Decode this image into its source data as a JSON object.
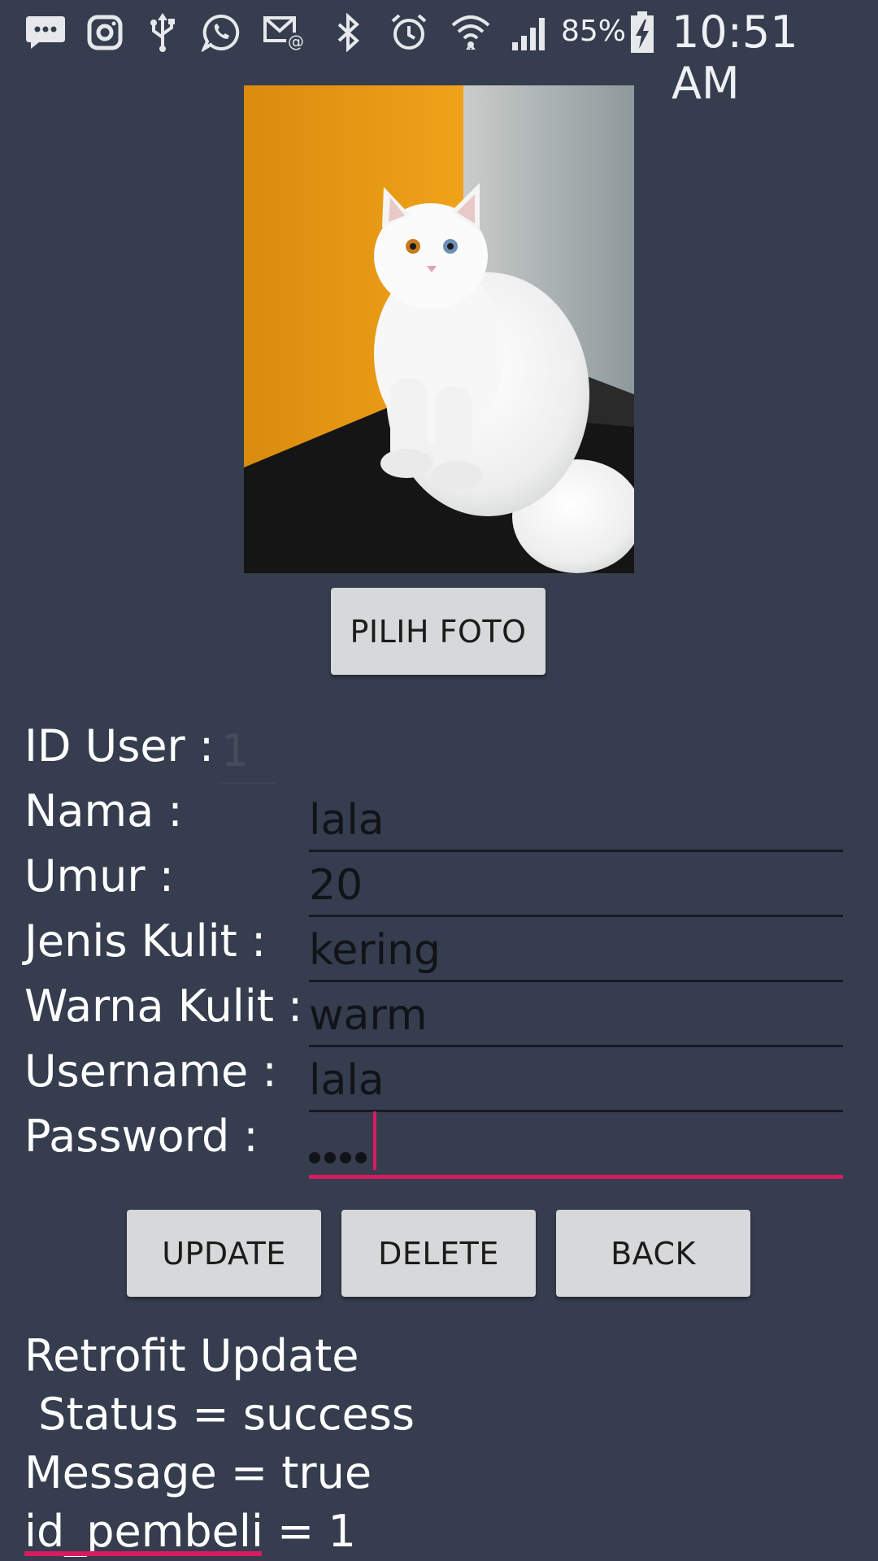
{
  "status_bar": {
    "icons": [
      "messenger-icon",
      "instagram-icon",
      "usb-icon",
      "whatsapp-icon",
      "email-icon",
      "bluetooth-icon",
      "alarm-icon",
      "wifi-icon",
      "signal-icon",
      "battery-charging-icon"
    ],
    "battery": "85%",
    "time": "10:51 AM"
  },
  "photo": {
    "subject": "white persian cat",
    "icon": "cat-photo"
  },
  "buttons": {
    "pick_photo": "PILIH FOTO",
    "update": "UPDATE",
    "delete": "DELETE",
    "back": "BACK"
  },
  "form": {
    "id_user_label": "ID User :",
    "id_user_value": "1",
    "fields": [
      {
        "label": "Nama :",
        "value": "lala"
      },
      {
        "label": "Umur :",
        "value": "20"
      },
      {
        "label": "Jenis Kulit :",
        "value": "kering"
      },
      {
        "label": "Warna Kulit :",
        "value": "warm"
      },
      {
        "label": "Username :",
        "value": "lala"
      },
      {
        "label": "Password :",
        "value": "lala"
      }
    ]
  },
  "result": {
    "line1": "Retrofit Update",
    "line2": " Status = success",
    "line3": "Message = true",
    "line4": "id_pembeli = 1"
  },
  "colors": {
    "background": "#353d4e",
    "button": "#d7d8d9",
    "accent": "#d81b60"
  }
}
